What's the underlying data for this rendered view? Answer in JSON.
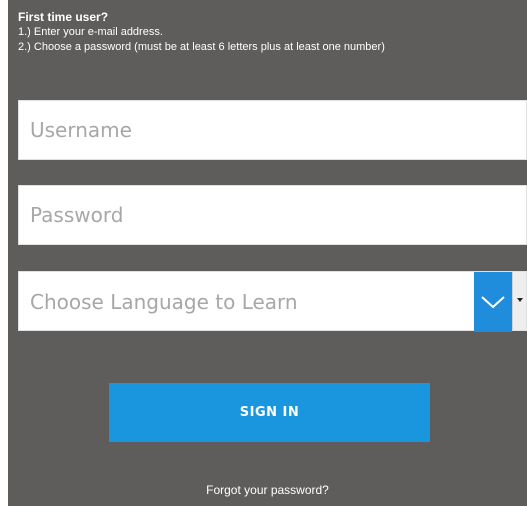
{
  "instructions": {
    "heading": "First time user?",
    "step1": "1.) Enter your e-mail address.",
    "step2": "2.) Choose a password (must be at least 6 letters plus at least one number)"
  },
  "form": {
    "username_placeholder": "Username",
    "password_placeholder": "Password",
    "language_placeholder": "Choose Language to Learn",
    "signin_label": "SIGN IN",
    "forgot_link": "Forgot your password?"
  },
  "icons": {
    "dropdown": "chevron-down-icon",
    "scroll_caret": "caret-down-icon"
  },
  "colors": {
    "panel_bg": "#5e5d5b",
    "accent": "#1a96df",
    "input_bg": "#ffffff",
    "placeholder": "#a7a7a7"
  }
}
